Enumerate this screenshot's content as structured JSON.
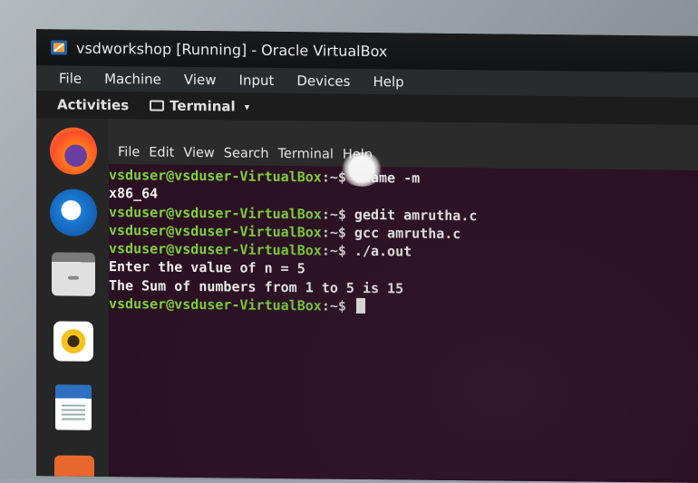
{
  "window": {
    "title": "vsdworkshop [Running] - Oracle VirtualBox"
  },
  "vbox_menu": [
    "File",
    "Machine",
    "View",
    "Input",
    "Devices",
    "Help"
  ],
  "gnome_bar": {
    "activities": "Activities",
    "app_name": "Terminal",
    "app_caret": "▾"
  },
  "dock": {
    "apps": [
      "firefox-icon",
      "thunderbird-icon",
      "files-icon",
      "rhythmbox-icon",
      "libreoffice-writer-icon",
      "software-icon"
    ]
  },
  "terminal": {
    "menu": [
      "File",
      "Edit",
      "View",
      "Search",
      "Terminal",
      "Help"
    ],
    "prompt_user": "vsduser@vsduser-VirtualBox",
    "prompt_suffix": ":~$",
    "lines": [
      {
        "type": "cmd",
        "text": " uname -m"
      },
      {
        "type": "out",
        "text": "x86_64"
      },
      {
        "type": "cmd",
        "text": " gedit amrutha.c"
      },
      {
        "type": "cmd",
        "text": " gcc amrutha.c"
      },
      {
        "type": "cmd",
        "text": " ./a.out"
      },
      {
        "type": "out",
        "text": "Enter the value of n = 5"
      },
      {
        "type": "out",
        "text": "The Sum of numbers from 1 to 5 is 15"
      },
      {
        "type": "cmd",
        "text": " "
      }
    ]
  },
  "colors": {
    "terminal_bg": "#2b1021",
    "prompt_green": "#7fd33e",
    "text": "#f2f2f2"
  }
}
